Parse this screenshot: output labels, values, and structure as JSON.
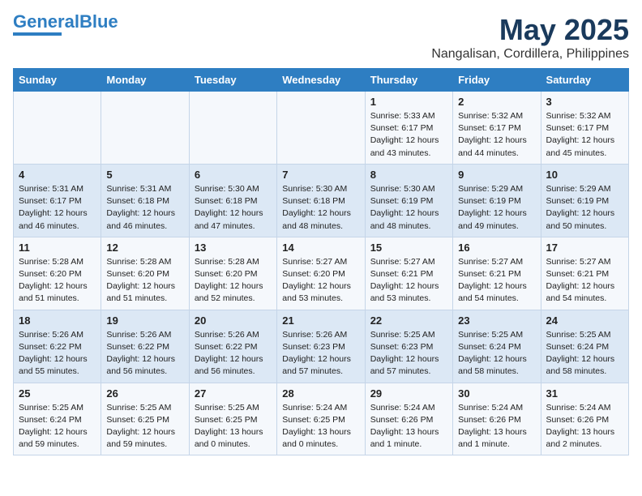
{
  "logo": {
    "part1": "General",
    "part2": "Blue"
  },
  "title": "May 2025",
  "location": "Nangalisan, Cordillera, Philippines",
  "days_of_week": [
    "Sunday",
    "Monday",
    "Tuesday",
    "Wednesday",
    "Thursday",
    "Friday",
    "Saturday"
  ],
  "weeks": [
    [
      {
        "day": "",
        "text": ""
      },
      {
        "day": "",
        "text": ""
      },
      {
        "day": "",
        "text": ""
      },
      {
        "day": "",
        "text": ""
      },
      {
        "day": "1",
        "text": "Sunrise: 5:33 AM\nSunset: 6:17 PM\nDaylight: 12 hours\nand 43 minutes."
      },
      {
        "day": "2",
        "text": "Sunrise: 5:32 AM\nSunset: 6:17 PM\nDaylight: 12 hours\nand 44 minutes."
      },
      {
        "day": "3",
        "text": "Sunrise: 5:32 AM\nSunset: 6:17 PM\nDaylight: 12 hours\nand 45 minutes."
      }
    ],
    [
      {
        "day": "4",
        "text": "Sunrise: 5:31 AM\nSunset: 6:17 PM\nDaylight: 12 hours\nand 46 minutes."
      },
      {
        "day": "5",
        "text": "Sunrise: 5:31 AM\nSunset: 6:18 PM\nDaylight: 12 hours\nand 46 minutes."
      },
      {
        "day": "6",
        "text": "Sunrise: 5:30 AM\nSunset: 6:18 PM\nDaylight: 12 hours\nand 47 minutes."
      },
      {
        "day": "7",
        "text": "Sunrise: 5:30 AM\nSunset: 6:18 PM\nDaylight: 12 hours\nand 48 minutes."
      },
      {
        "day": "8",
        "text": "Sunrise: 5:30 AM\nSunset: 6:19 PM\nDaylight: 12 hours\nand 48 minutes."
      },
      {
        "day": "9",
        "text": "Sunrise: 5:29 AM\nSunset: 6:19 PM\nDaylight: 12 hours\nand 49 minutes."
      },
      {
        "day": "10",
        "text": "Sunrise: 5:29 AM\nSunset: 6:19 PM\nDaylight: 12 hours\nand 50 minutes."
      }
    ],
    [
      {
        "day": "11",
        "text": "Sunrise: 5:28 AM\nSunset: 6:20 PM\nDaylight: 12 hours\nand 51 minutes."
      },
      {
        "day": "12",
        "text": "Sunrise: 5:28 AM\nSunset: 6:20 PM\nDaylight: 12 hours\nand 51 minutes."
      },
      {
        "day": "13",
        "text": "Sunrise: 5:28 AM\nSunset: 6:20 PM\nDaylight: 12 hours\nand 52 minutes."
      },
      {
        "day": "14",
        "text": "Sunrise: 5:27 AM\nSunset: 6:20 PM\nDaylight: 12 hours\nand 53 minutes."
      },
      {
        "day": "15",
        "text": "Sunrise: 5:27 AM\nSunset: 6:21 PM\nDaylight: 12 hours\nand 53 minutes."
      },
      {
        "day": "16",
        "text": "Sunrise: 5:27 AM\nSunset: 6:21 PM\nDaylight: 12 hours\nand 54 minutes."
      },
      {
        "day": "17",
        "text": "Sunrise: 5:27 AM\nSunset: 6:21 PM\nDaylight: 12 hours\nand 54 minutes."
      }
    ],
    [
      {
        "day": "18",
        "text": "Sunrise: 5:26 AM\nSunset: 6:22 PM\nDaylight: 12 hours\nand 55 minutes."
      },
      {
        "day": "19",
        "text": "Sunrise: 5:26 AM\nSunset: 6:22 PM\nDaylight: 12 hours\nand 56 minutes."
      },
      {
        "day": "20",
        "text": "Sunrise: 5:26 AM\nSunset: 6:22 PM\nDaylight: 12 hours\nand 56 minutes."
      },
      {
        "day": "21",
        "text": "Sunrise: 5:26 AM\nSunset: 6:23 PM\nDaylight: 12 hours\nand 57 minutes."
      },
      {
        "day": "22",
        "text": "Sunrise: 5:25 AM\nSunset: 6:23 PM\nDaylight: 12 hours\nand 57 minutes."
      },
      {
        "day": "23",
        "text": "Sunrise: 5:25 AM\nSunset: 6:24 PM\nDaylight: 12 hours\nand 58 minutes."
      },
      {
        "day": "24",
        "text": "Sunrise: 5:25 AM\nSunset: 6:24 PM\nDaylight: 12 hours\nand 58 minutes."
      }
    ],
    [
      {
        "day": "25",
        "text": "Sunrise: 5:25 AM\nSunset: 6:24 PM\nDaylight: 12 hours\nand 59 minutes."
      },
      {
        "day": "26",
        "text": "Sunrise: 5:25 AM\nSunset: 6:25 PM\nDaylight: 12 hours\nand 59 minutes."
      },
      {
        "day": "27",
        "text": "Sunrise: 5:25 AM\nSunset: 6:25 PM\nDaylight: 13 hours\nand 0 minutes."
      },
      {
        "day": "28",
        "text": "Sunrise: 5:24 AM\nSunset: 6:25 PM\nDaylight: 13 hours\nand 0 minutes."
      },
      {
        "day": "29",
        "text": "Sunrise: 5:24 AM\nSunset: 6:26 PM\nDaylight: 13 hours\nand 1 minute."
      },
      {
        "day": "30",
        "text": "Sunrise: 5:24 AM\nSunset: 6:26 PM\nDaylight: 13 hours\nand 1 minute."
      },
      {
        "day": "31",
        "text": "Sunrise: 5:24 AM\nSunset: 6:26 PM\nDaylight: 13 hours\nand 2 minutes."
      }
    ]
  ]
}
